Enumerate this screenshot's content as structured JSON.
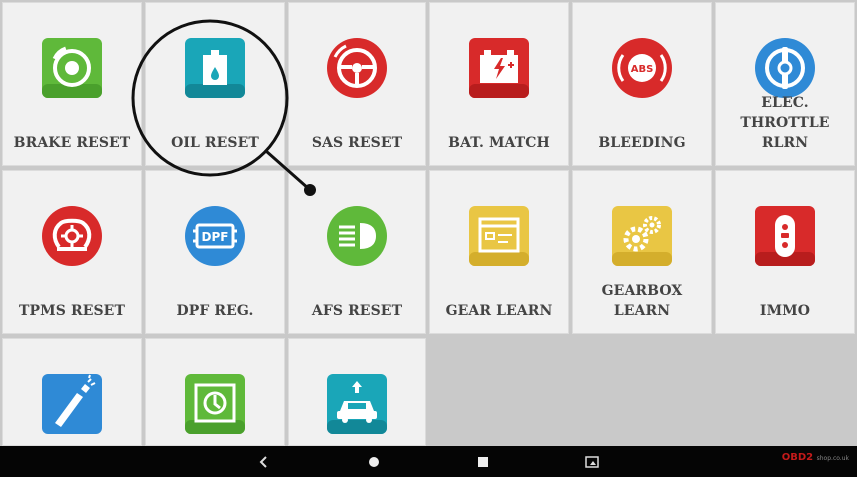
{
  "tiles": [
    {
      "label": "BRAKE RESET",
      "icon": "brake-disc-icon"
    },
    {
      "label": "OIL RESET",
      "icon": "oil-can-icon"
    },
    {
      "label": "SAS RESET",
      "icon": "steering-wheel-icon"
    },
    {
      "label": "BAT. MATCH",
      "icon": "battery-icon"
    },
    {
      "label": "BLEEDING",
      "icon": "abs-icon",
      "icon_text": "ABS"
    },
    {
      "label": "ELEC. THROTTLE RLRN",
      "icon": "throttle-icon"
    },
    {
      "label": "TPMS RESET",
      "icon": "tire-pressure-icon"
    },
    {
      "label": "DPF REG.",
      "icon": "dpf-icon",
      "icon_text": "DPF"
    },
    {
      "label": "AFS RESET",
      "icon": "headlight-icon"
    },
    {
      "label": "GEAR LEARN",
      "icon": "gear-window-icon"
    },
    {
      "label": "GEARBOX LEARN",
      "icon": "gearbox-gears-icon"
    },
    {
      "label": "IMMO",
      "icon": "car-key-icon"
    },
    {
      "label": "",
      "icon": "injector-icon"
    },
    {
      "label": "",
      "icon": "suspension-icon"
    },
    {
      "label": "",
      "icon": "car-lift-icon"
    }
  ],
  "navbar": {
    "back": "back-icon",
    "home": "home-icon",
    "recents": "recents-icon",
    "screenshot": "screenshot-icon"
  },
  "watermark": {
    "brand": "OBD2",
    "site": "shop.co.uk"
  },
  "colors": {
    "green": "#5fb93a",
    "teal": "#1aa6b8",
    "red": "#d82a2a",
    "blue": "#2f8ad6",
    "yellow": "#e9c644",
    "background": "#c9c9c9",
    "tile": "#f1f1f1"
  }
}
